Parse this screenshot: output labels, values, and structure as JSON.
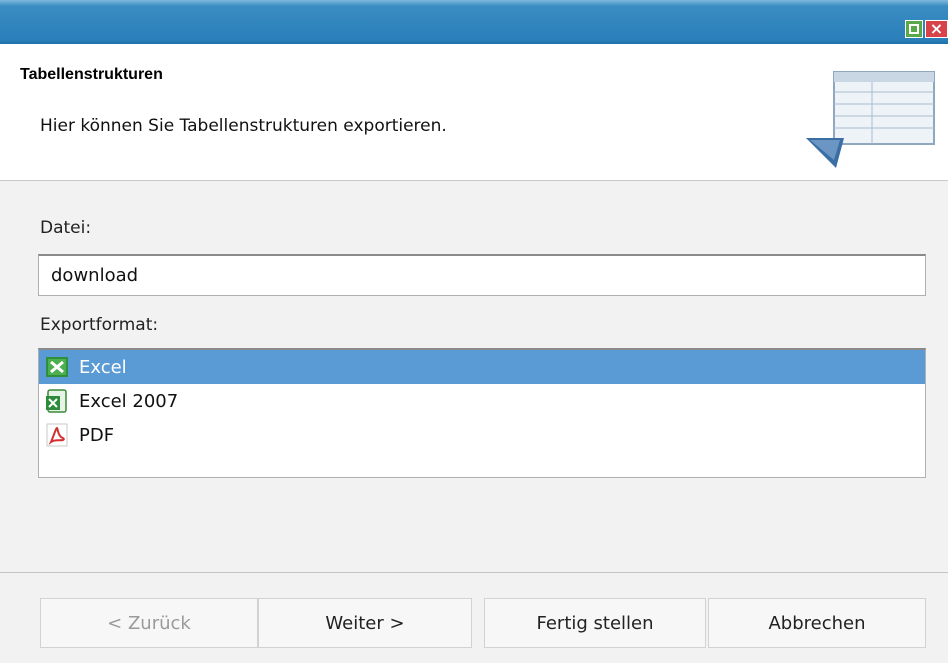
{
  "window": {
    "maximize_icon": "maximize-icon",
    "close_icon": "close-icon",
    "close_glyph": "×"
  },
  "header": {
    "title": "Tabellenstrukturen",
    "description": "Hier können Sie Tabellenstrukturen exportieren.",
    "icon": "table-structure-icon"
  },
  "form": {
    "file_label": "Datei:",
    "file_value": "download",
    "format_label": "Exportformat:",
    "formats": [
      {
        "label": "Excel",
        "icon": "excel-icon",
        "selected": true
      },
      {
        "label": "Excel 2007",
        "icon": "excel-2007-icon",
        "selected": false
      },
      {
        "label": "PDF",
        "icon": "pdf-icon",
        "selected": false
      }
    ]
  },
  "buttons": {
    "back": "< Zurück",
    "next": "Weiter >",
    "finish": "Fertig stellen",
    "cancel": "Abbrechen"
  },
  "colors": {
    "titlebar": "#2a7fba",
    "selection": "#5a9bd6"
  }
}
